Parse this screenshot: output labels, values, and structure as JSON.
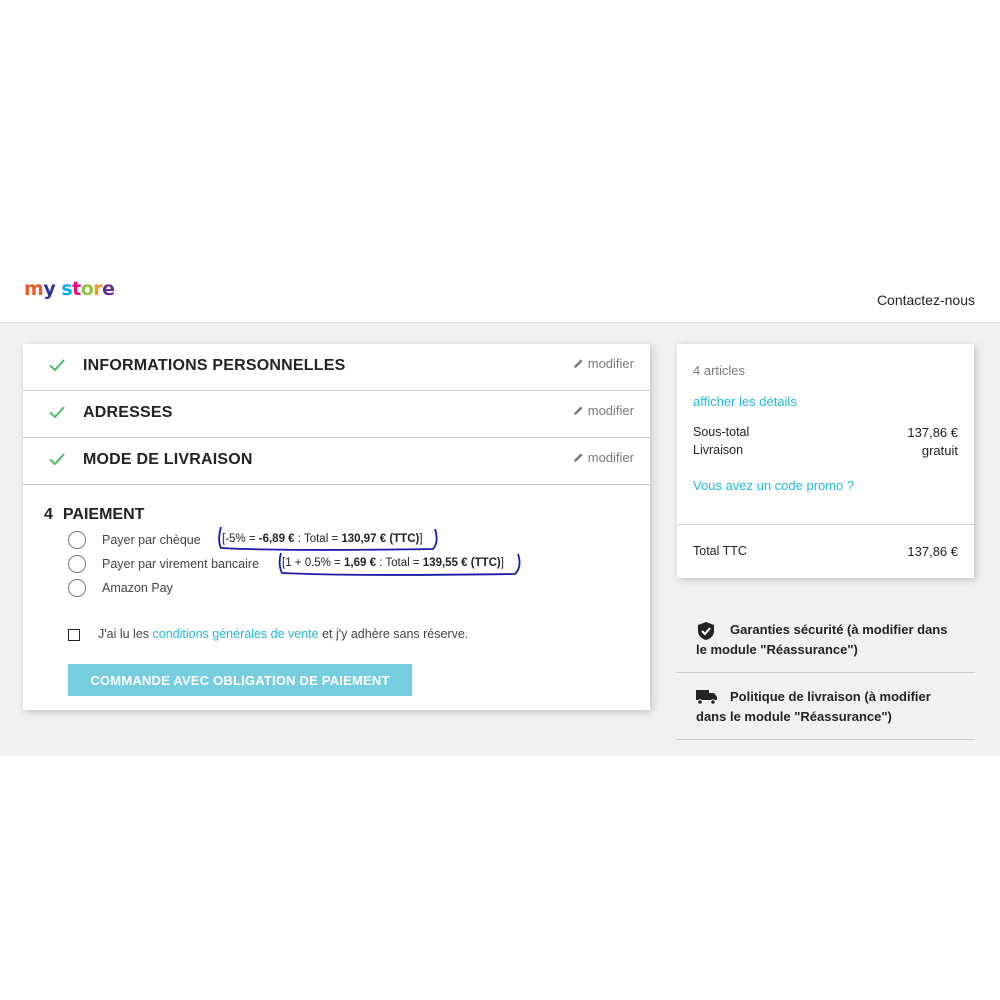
{
  "header": {
    "logo": {
      "parts": [
        "m",
        "y",
        " ",
        "s",
        "t",
        "o",
        "r",
        "e"
      ]
    },
    "contact_label": "Contactez-nous"
  },
  "checkout": {
    "steps": [
      {
        "title": "INFORMATIONS PERSONNELLES",
        "modify_label": "modifier",
        "icon": "check-icon"
      },
      {
        "title": "ADRESSES",
        "modify_label": "modifier",
        "icon": "check-icon"
      },
      {
        "title": "MODE DE LIVRAISON",
        "modify_label": "modifier",
        "icon": "check-icon"
      }
    ],
    "payment": {
      "number": "4",
      "title": "PAIEMENT",
      "options": [
        {
          "label": "Payer par chèque",
          "promo_prefix": "[-5% = ",
          "promo_amount": "-6,89 €",
          "promo_mid": " : Total = ",
          "promo_total": "130,97 € (TTC)",
          "promo_suffix": "]"
        },
        {
          "label": "Payer par virement bancaire",
          "promo_prefix": "[1 + 0.5% = ",
          "promo_amount": "1,69 €",
          "promo_mid": " : Total = ",
          "promo_total": "139,55 € (TTC)",
          "promo_suffix": "]"
        },
        {
          "label": "Amazon Pay"
        }
      ],
      "terms_before": "J'ai lu les ",
      "terms_link": "conditions générales de vente",
      "terms_after": " et j'y adhère sans réserve.",
      "order_button": "COMMANDE AVEC OBLIGATION DE PAIEMENT"
    }
  },
  "summary": {
    "count": "4 articles",
    "details_link": "afficher les détails",
    "subtotal_label": "Sous-total",
    "subtotal_value": "137,86 €",
    "shipping_label": "Livraison",
    "shipping_value": "gratuit",
    "promo_link": "Vous avez un code promo ?",
    "total_label": "Total TTC",
    "total_value": "137,86 €"
  },
  "reassurance": [
    {
      "icon": "shield-check-icon",
      "text": "Garanties sécurité (à modifier dans le module \"Réassurance\")"
    },
    {
      "icon": "truck-icon",
      "text": "Politique de livraison (à modifier dans le module \"Réassurance\")"
    }
  ],
  "colors": {
    "accent": "#24b9d7",
    "button": "#77cde0",
    "check": "#4cbb6c",
    "annotation_ink": "#1a1aa8"
  }
}
